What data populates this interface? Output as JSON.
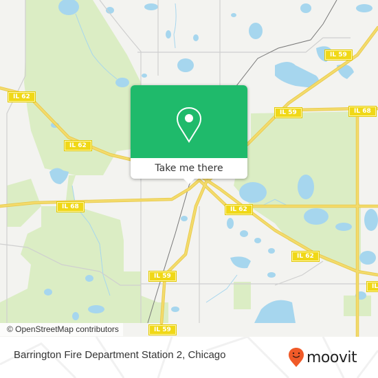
{
  "map": {
    "colors": {
      "background": "#f3f3f0",
      "park": "#dbedc4",
      "water": "#a6d6ee",
      "highway": "#f3db6c",
      "highway_casing": "#e8c94a",
      "minor_road": "#cfcfcf",
      "railway": "#777777",
      "shield": "#f0d817"
    },
    "road_shields": [
      {
        "label": "IL 62",
        "name": "il-62-shield-west"
      },
      {
        "label": "IL 62",
        "name": "il-62-shield-west-2"
      },
      {
        "label": "IL 68",
        "name": "il-68-shield-west"
      },
      {
        "label": "IL 59",
        "name": "il-59-shield-north"
      },
      {
        "label": "IL 59",
        "name": "il-59-shield-east"
      },
      {
        "label": "IL 68",
        "name": "il-68-shield-east"
      },
      {
        "label": "IL 62",
        "name": "il-62-shield-center"
      },
      {
        "label": "IL 62",
        "name": "il-62-shield-southeast"
      },
      {
        "label": "IL 59",
        "name": "il-59-shield-south"
      },
      {
        "label": "IL 59",
        "name": "il-59-shield-bottom"
      },
      {
        "label": "IL",
        "name": "il-shield-edge-right"
      }
    ],
    "attribution": "© OpenStreetMap contributors"
  },
  "popup": {
    "icon": "location-pin-icon",
    "action_label": "Take me there",
    "accent_color": "#1fba6b"
  },
  "footer": {
    "place_title": "Barrington Fire Department Station 2, Chicago",
    "brand": "moovit",
    "brand_color": "#f05a28"
  }
}
